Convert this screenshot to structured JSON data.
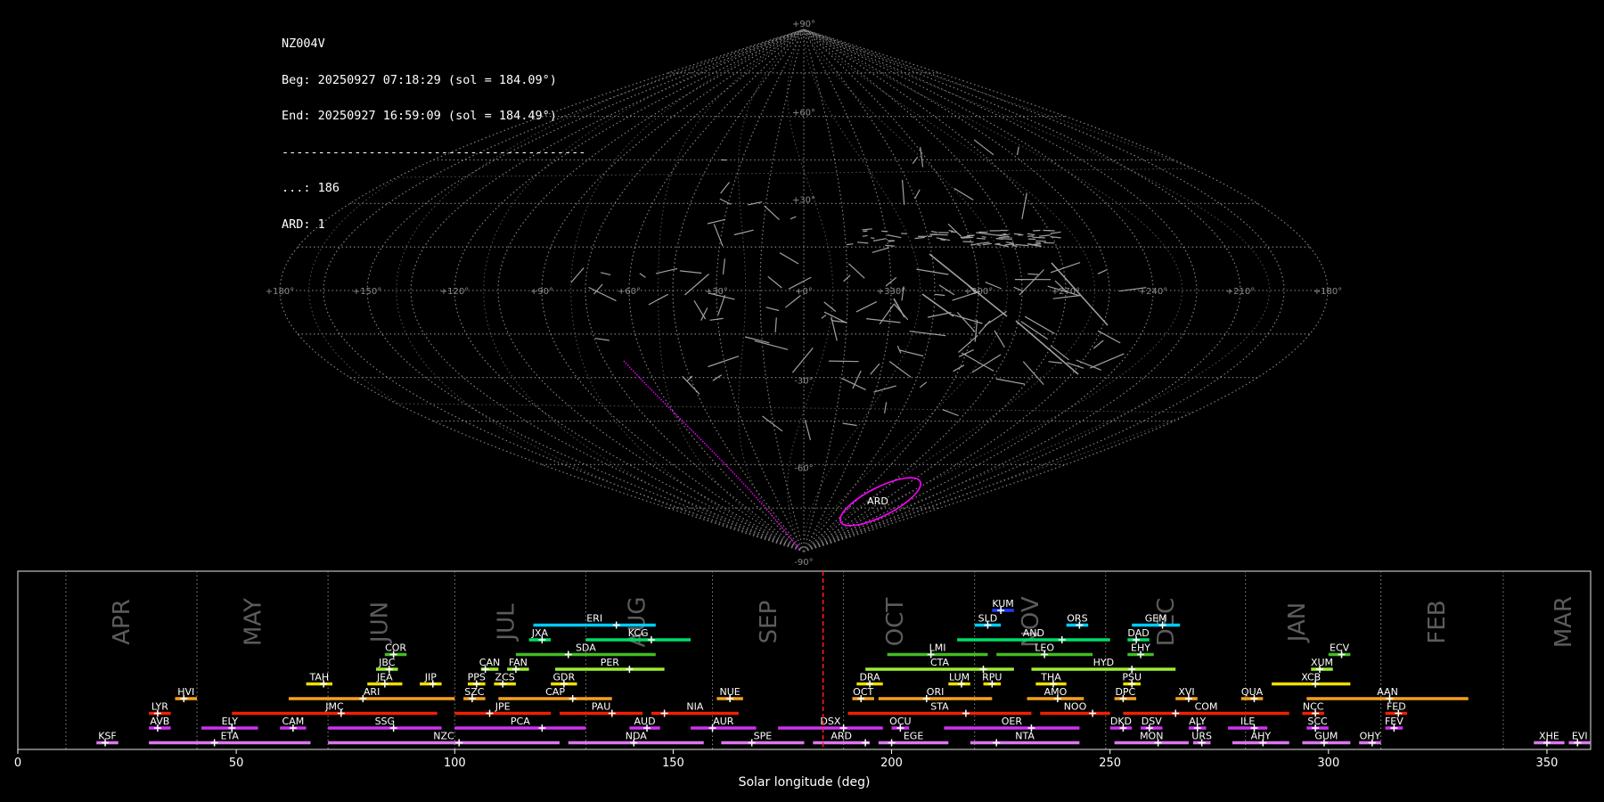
{
  "info": {
    "station": "NZ004V",
    "beg": "Beg: 20250927 07:18:29 (sol = 184.09°)",
    "end": "End: 20250927 16:59:09 (sol = 184.49°)",
    "separator": "------------------------------------------",
    "count_sporadic": "...: 186",
    "count_shower": "ARD: 1"
  },
  "sky_map": {
    "projection": "sinusoidal",
    "lat_labels": [
      "+90°",
      "+60°",
      "+30°",
      "-30°",
      "-60°",
      "-90°"
    ],
    "lon_labels": [
      "+180°",
      "+150°",
      "+120°",
      "+90°",
      "+60°",
      "+30°",
      "+0°",
      "+330°",
      "+300°",
      "+270°",
      "+240°",
      "+210°",
      "+180°"
    ],
    "shower_label": "ARD",
    "colors": {
      "grid": "#8a8a8a",
      "meteor_trail": "#bdbdbd",
      "shower_trail": "#ff00ff",
      "radiant_ellipse": "#ff00ff"
    }
  },
  "chart_data": {
    "type": "range-bar",
    "xlabel": "Solar longitude (deg)",
    "ylabel": "",
    "xlim": [
      0,
      360
    ],
    "xticks": [
      "0",
      "50",
      "100",
      "150",
      "200",
      "250",
      "300",
      "350"
    ],
    "grid": true,
    "current_sol": 184.3,
    "months": [
      {
        "name": "APR",
        "sol": 24
      },
      {
        "name": "MAY",
        "sol": 54
      },
      {
        "name": "JUN",
        "sol": 83
      },
      {
        "name": "JUL",
        "sol": 112
      },
      {
        "name": "AUG",
        "sol": 142
      },
      {
        "name": "SEP",
        "sol": 172
      },
      {
        "name": "OCT",
        "sol": 201
      },
      {
        "name": "NOV",
        "sol": 232
      },
      {
        "name": "DEC",
        "sol": 263
      },
      {
        "name": "JAN",
        "sol": 293
      },
      {
        "name": "FEB",
        "sol": 325
      },
      {
        "name": "MAR",
        "sol": 354
      }
    ],
    "month_boundaries": [
      11,
      41,
      71,
      100,
      130,
      159,
      189,
      219,
      249,
      281,
      312,
      340
    ],
    "showers": [
      {
        "name": "KUM",
        "start": 223,
        "end": 228,
        "peak": 225,
        "row": 8,
        "color": "#1f3cff"
      },
      {
        "name": "ERI",
        "start": 118,
        "end": 146,
        "peak": 137,
        "row": 7,
        "color": "#00ccff"
      },
      {
        "name": "SLD",
        "start": 219,
        "end": 225,
        "peak": 222,
        "row": 7,
        "color": "#00ccff"
      },
      {
        "name": "ORS",
        "start": 240,
        "end": 245,
        "peak": 243,
        "row": 7,
        "color": "#00ccff"
      },
      {
        "name": "GEM",
        "start": 255,
        "end": 266,
        "peak": 262,
        "row": 7,
        "color": "#00ccff"
      },
      {
        "name": "JXA",
        "start": 117,
        "end": 122,
        "peak": 120,
        "row": 6,
        "color": "#00dd66"
      },
      {
        "name": "KCG",
        "start": 130,
        "end": 154,
        "peak": 145,
        "row": 6,
        "color": "#00dd66"
      },
      {
        "name": "AND",
        "start": 215,
        "end": 250,
        "peak": 239,
        "row": 6,
        "color": "#00dd66"
      },
      {
        "name": "DAD",
        "start": 254,
        "end": 259,
        "peak": 256,
        "row": 6,
        "color": "#00dd66"
      },
      {
        "name": "COR",
        "start": 84,
        "end": 89,
        "peak": 86,
        "row": 5,
        "color": "#44bb22"
      },
      {
        "name": "SDA",
        "start": 114,
        "end": 146,
        "peak": 126,
        "row": 5,
        "color": "#44bb22"
      },
      {
        "name": "LMI",
        "start": 199,
        "end": 222,
        "peak": 209,
        "row": 5,
        "color": "#44bb22"
      },
      {
        "name": "LEO",
        "start": 224,
        "end": 246,
        "peak": 235,
        "row": 5,
        "color": "#44bb22"
      },
      {
        "name": "EHY",
        "start": 254,
        "end": 260,
        "peak": 257,
        "row": 5,
        "color": "#44bb22"
      },
      {
        "name": "ECV",
        "start": 300,
        "end": 305,
        "peak": 303,
        "row": 5,
        "color": "#44bb22"
      },
      {
        "name": "JBC",
        "start": 82,
        "end": 87,
        "peak": 85,
        "row": 4,
        "color": "#99ee33"
      },
      {
        "name": "CAN",
        "start": 106,
        "end": 110,
        "peak": 107,
        "row": 4,
        "color": "#99ee33"
      },
      {
        "name": "FAN",
        "start": 112,
        "end": 117,
        "peak": 114,
        "row": 4,
        "color": "#99ee33"
      },
      {
        "name": "PER",
        "start": 123,
        "end": 148,
        "peak": 140,
        "row": 4,
        "color": "#99ee33"
      },
      {
        "name": "CTA",
        "start": 194,
        "end": 228,
        "peak": 221,
        "row": 4,
        "color": "#99ee33"
      },
      {
        "name": "HYD",
        "start": 232,
        "end": 265,
        "peak": 255,
        "row": 4,
        "color": "#99ee33"
      },
      {
        "name": "XUM",
        "start": 296,
        "end": 301,
        "peak": 298,
        "row": 4,
        "color": "#99ee33"
      },
      {
        "name": "TAH",
        "start": 66,
        "end": 72,
        "peak": 70,
        "row": 3,
        "color": "#eedd00"
      },
      {
        "name": "JEA",
        "start": 80,
        "end": 88,
        "peak": 84,
        "row": 3,
        "color": "#eedd00"
      },
      {
        "name": "JIP",
        "start": 92,
        "end": 97,
        "peak": 95,
        "row": 3,
        "color": "#eedd00"
      },
      {
        "name": "PPS",
        "start": 103,
        "end": 107,
        "peak": 105,
        "row": 3,
        "color": "#eedd00"
      },
      {
        "name": "ZCS",
        "start": 109,
        "end": 114,
        "peak": 111,
        "row": 3,
        "color": "#eedd00"
      },
      {
        "name": "GDR",
        "start": 122,
        "end": 128,
        "peak": 125,
        "row": 3,
        "color": "#eedd00"
      },
      {
        "name": "DRA",
        "start": 192,
        "end": 198,
        "peak": 195,
        "row": 3,
        "color": "#eedd00"
      },
      {
        "name": "LUM",
        "start": 213,
        "end": 218,
        "peak": 216,
        "row": 3,
        "color": "#eedd00"
      },
      {
        "name": "RPU",
        "start": 221,
        "end": 225,
        "peak": 223,
        "row": 3,
        "color": "#eedd00"
      },
      {
        "name": "THA",
        "start": 233,
        "end": 240,
        "peak": 237,
        "row": 3,
        "color": "#eedd00"
      },
      {
        "name": "PSU",
        "start": 253,
        "end": 257,
        "peak": 255,
        "row": 3,
        "color": "#eedd00"
      },
      {
        "name": "XCB",
        "start": 287,
        "end": 305,
        "peak": 297,
        "row": 3,
        "color": "#eedd00"
      },
      {
        "name": "HVI",
        "start": 36,
        "end": 41,
        "peak": 38,
        "row": 2,
        "color": "#f5a020"
      },
      {
        "name": "ARI",
        "start": 62,
        "end": 100,
        "peak": 79,
        "row": 2,
        "color": "#f5a020"
      },
      {
        "name": "SZC",
        "start": 102,
        "end": 107,
        "peak": 104,
        "row": 2,
        "color": "#f5a020"
      },
      {
        "name": "CAP",
        "start": 110,
        "end": 136,
        "peak": 127,
        "row": 2,
        "color": "#f5a020"
      },
      {
        "name": "NUE",
        "start": 160,
        "end": 166,
        "peak": 163,
        "row": 2,
        "color": "#f5a020"
      },
      {
        "name": "OCT",
        "start": 191,
        "end": 196,
        "peak": 193,
        "row": 2,
        "color": "#f5a020"
      },
      {
        "name": "ORI",
        "start": 197,
        "end": 223,
        "peak": 208,
        "row": 2,
        "color": "#f5a020"
      },
      {
        "name": "AMO",
        "start": 231,
        "end": 244,
        "peak": 238,
        "row": 2,
        "color": "#f5a020"
      },
      {
        "name": "DPC",
        "start": 251,
        "end": 256,
        "peak": 253,
        "row": 2,
        "color": "#f5a020"
      },
      {
        "name": "XVI",
        "start": 265,
        "end": 270,
        "peak": 268,
        "row": 2,
        "color": "#f5a020"
      },
      {
        "name": "QUA",
        "start": 280,
        "end": 285,
        "peak": 283,
        "row": 2,
        "color": "#f5a020"
      },
      {
        "name": "AAN",
        "start": 295,
        "end": 332,
        "peak": 314,
        "row": 2,
        "color": "#f5a020"
      },
      {
        "name": "LYR",
        "start": 30,
        "end": 35,
        "peak": 32,
        "row": 1,
        "color": "#ee2200"
      },
      {
        "name": "JMC",
        "start": 49,
        "end": 96,
        "peak": 74,
        "row": 1,
        "color": "#ee2200"
      },
      {
        "name": "JPE",
        "start": 100,
        "end": 122,
        "peak": 108,
        "row": 1,
        "color": "#ee2200"
      },
      {
        "name": "PAU",
        "start": 124,
        "end": 143,
        "peak": 136,
        "row": 1,
        "color": "#ee2200"
      },
      {
        "name": "NIA",
        "start": 145,
        "end": 165,
        "peak": 148,
        "row": 1,
        "color": "#ee2200"
      },
      {
        "name": "STA",
        "start": 190,
        "end": 232,
        "peak": 217,
        "row": 1,
        "color": "#ee2200"
      },
      {
        "name": "NOO",
        "start": 234,
        "end": 250,
        "peak": 246,
        "row": 1,
        "color": "#ee2200"
      },
      {
        "name": "COM",
        "start": 253,
        "end": 291,
        "peak": 265,
        "row": 1,
        "color": "#ee2200"
      },
      {
        "name": "NCC",
        "start": 294,
        "end": 299,
        "peak": 297,
        "row": 1,
        "color": "#ee2200"
      },
      {
        "name": "FED",
        "start": 313,
        "end": 318,
        "peak": 316,
        "row": 1,
        "color": "#ee2200"
      },
      {
        "name": "AVB",
        "start": 30,
        "end": 35,
        "peak": 32,
        "row": 0,
        "color": "#cc33ee"
      },
      {
        "name": "ELY",
        "start": 42,
        "end": 55,
        "peak": 49,
        "row": 0,
        "color": "#cc33ee"
      },
      {
        "name": "CAM",
        "start": 60,
        "end": 66,
        "peak": 63,
        "row": 0,
        "color": "#cc33ee"
      },
      {
        "name": "SSG",
        "start": 71,
        "end": 97,
        "peak": 86,
        "row": 0,
        "color": "#cc33ee"
      },
      {
        "name": "PCA",
        "start": 100,
        "end": 130,
        "peak": 120,
        "row": 0,
        "color": "#cc33ee"
      },
      {
        "name": "AUD",
        "start": 140,
        "end": 147,
        "peak": 144,
        "row": 0,
        "color": "#cc33ee"
      },
      {
        "name": "AUR",
        "start": 154,
        "end": 169,
        "peak": 159,
        "row": 0,
        "color": "#cc33ee"
      },
      {
        "name": "DSX",
        "start": 174,
        "end": 198,
        "peak": 189,
        "row": 0,
        "color": "#cc33ee"
      },
      {
        "name": "OCU",
        "start": 200,
        "end": 204,
        "peak": 202,
        "row": 0,
        "color": "#cc33ee"
      },
      {
        "name": "OER",
        "start": 212,
        "end": 243,
        "peak": 232,
        "row": 0,
        "color": "#cc33ee"
      },
      {
        "name": "DKD",
        "start": 250,
        "end": 255,
        "peak": 253,
        "row": 0,
        "color": "#cc33ee"
      },
      {
        "name": "DSV",
        "start": 257,
        "end": 262,
        "peak": 259,
        "row": 0,
        "color": "#cc33ee"
      },
      {
        "name": "ALY",
        "start": 268,
        "end": 272,
        "peak": 270,
        "row": 0,
        "color": "#cc33ee"
      },
      {
        "name": "ILE",
        "start": 277,
        "end": 286,
        "peak": 283,
        "row": 0,
        "color": "#cc33ee"
      },
      {
        "name": "SCC",
        "start": 295,
        "end": 300,
        "peak": 297,
        "row": 0,
        "color": "#cc33ee"
      },
      {
        "name": "FEV",
        "start": 313,
        "end": 317,
        "peak": 315,
        "row": 0,
        "color": "#cc33ee"
      },
      {
        "name": "KSF",
        "start": 18,
        "end": 23,
        "peak": 20,
        "row": -1,
        "color": "#dd77ee"
      },
      {
        "name": "ETA",
        "start": 30,
        "end": 67,
        "peak": 45,
        "row": -1,
        "color": "#dd77ee"
      },
      {
        "name": "NZC",
        "start": 71,
        "end": 124,
        "peak": 101,
        "row": -1,
        "color": "#dd77ee"
      },
      {
        "name": "NDA",
        "start": 126,
        "end": 157,
        "peak": 141,
        "row": -1,
        "color": "#dd77ee"
      },
      {
        "name": "SPE",
        "start": 161,
        "end": 180,
        "peak": 168,
        "row": -1,
        "color": "#dd77ee"
      },
      {
        "name": "ARD",
        "start": 182,
        "end": 195,
        "peak": 194,
        "row": -1,
        "color": "#dd77ee"
      },
      {
        "name": "EGE",
        "start": 197,
        "end": 213,
        "peak": 200,
        "row": -1,
        "color": "#dd77ee"
      },
      {
        "name": "NTA",
        "start": 218,
        "end": 243,
        "peak": 224,
        "row": -1,
        "color": "#dd77ee"
      },
      {
        "name": "MON",
        "start": 251,
        "end": 268,
        "peak": 261,
        "row": -1,
        "color": "#dd77ee"
      },
      {
        "name": "URS",
        "start": 269,
        "end": 273,
        "peak": 271,
        "row": -1,
        "color": "#dd77ee"
      },
      {
        "name": "AHY",
        "start": 278,
        "end": 291,
        "peak": 285,
        "row": -1,
        "color": "#dd77ee"
      },
      {
        "name": "GUM",
        "start": 294,
        "end": 305,
        "peak": 299,
        "row": -1,
        "color": "#dd77ee"
      },
      {
        "name": "OHY",
        "start": 307,
        "end": 312,
        "peak": 310,
        "row": -1,
        "color": "#dd77ee"
      },
      {
        "name": "XHE",
        "start": 347,
        "end": 354,
        "peak": 350,
        "row": -1,
        "color": "#dd77ee"
      },
      {
        "name": "EVI",
        "start": 355,
        "end": 360,
        "peak": 357,
        "row": -1,
        "color": "#dd77ee"
      }
    ]
  }
}
